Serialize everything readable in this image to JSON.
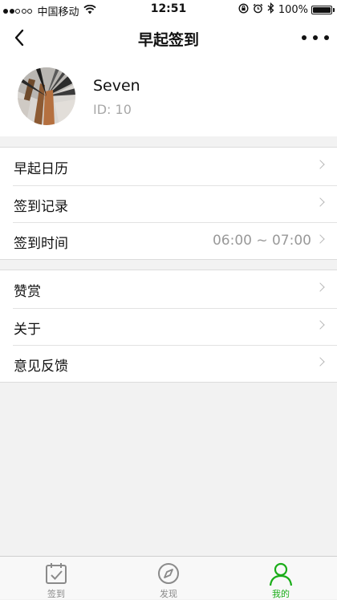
{
  "status_bar": {
    "carrier": "中国移动",
    "wifi": "ᯤ",
    "time": "12:51",
    "rotation_lock": "⊛",
    "alarm": "⏰",
    "bluetooth": "∦",
    "battery_percent": "100%"
  },
  "nav": {
    "title": "早起签到"
  },
  "profile": {
    "name": "Seven",
    "id_text": "ID: 10"
  },
  "group1": [
    {
      "label": "早起日历",
      "value": ""
    },
    {
      "label": "签到记录",
      "value": ""
    },
    {
      "label": "签到时间",
      "value": "06:00 ~ 07:00"
    }
  ],
  "group2": [
    {
      "label": "赞赏",
      "value": ""
    },
    {
      "label": "关于",
      "value": ""
    },
    {
      "label": "意见反馈",
      "value": ""
    }
  ],
  "tabs": [
    {
      "label": "签到",
      "icon": "calendar-check-icon",
      "active": false
    },
    {
      "label": "发现",
      "icon": "compass-icon",
      "active": false
    },
    {
      "label": "我的",
      "icon": "person-icon",
      "active": true
    }
  ],
  "colors": {
    "active_tab": "#1aad19",
    "inactive_tab": "#8a8a8a",
    "background": "#f2f2f2"
  }
}
